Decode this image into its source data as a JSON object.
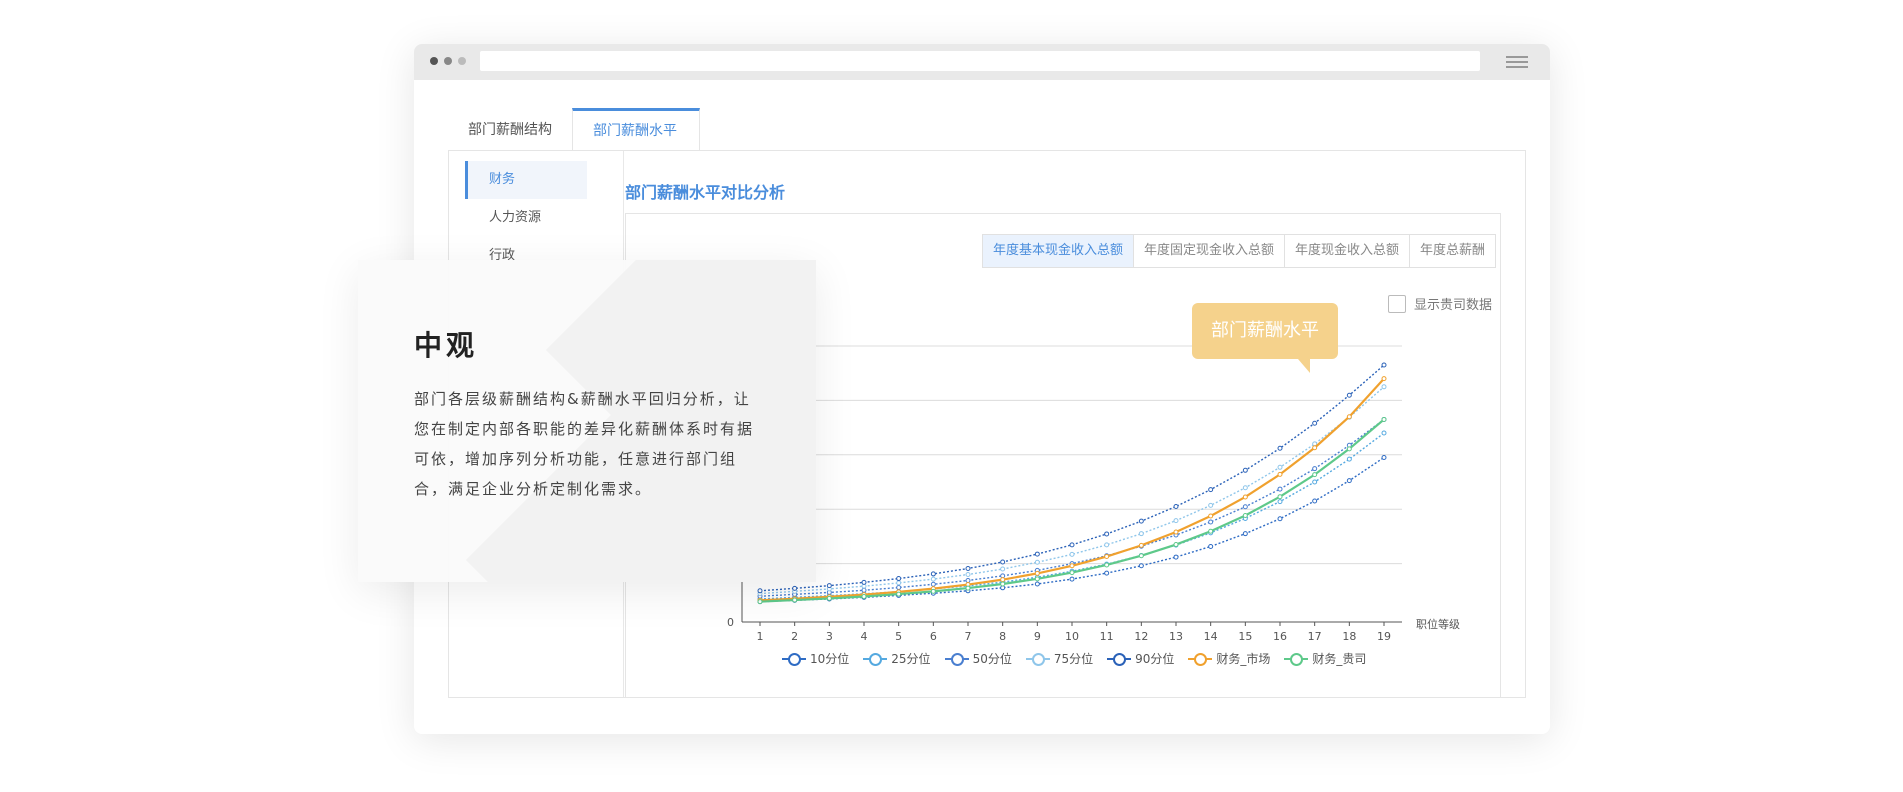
{
  "tabs": [
    {
      "label": "部门薪酬结构",
      "active": false
    },
    {
      "label": "部门薪酬水平",
      "active": true
    }
  ],
  "sidebar": {
    "items": [
      {
        "label": "财务",
        "active": true
      },
      {
        "label": "人力资源",
        "active": false
      },
      {
        "label": "行政",
        "active": false
      }
    ]
  },
  "main": {
    "title": "部门薪酬水平对比分析",
    "segments": [
      {
        "label": "年度基本现金收入总额",
        "active": true
      },
      {
        "label": "年度固定现金收入总额",
        "active": false
      },
      {
        "label": "年度现金收入总额",
        "active": false
      },
      {
        "label": "年度总薪酬",
        "active": false
      }
    ],
    "checkbox_label": "显示贵司数据",
    "checkbox_checked": false
  },
  "tooltip": {
    "text": "部门薪酬水平"
  },
  "card": {
    "title": "中观",
    "text": "部门各层级薪酬结构&薪酬水平回归分析，让您在制定内部各职能的差异化薪酬体系时有据可依，增加序列分析功能，任意进行部门组合，满足企业分析定制化需求。"
  },
  "chart_data": {
    "type": "line",
    "x": [
      1,
      2,
      3,
      4,
      5,
      6,
      7,
      8,
      9,
      10,
      11,
      12,
      13,
      14,
      15,
      16,
      17,
      18,
      19
    ],
    "xlabel": "职位等级",
    "ylabel": "",
    "y_tick_visible": "0",
    "ylim": [
      0,
      100
    ],
    "grid": true,
    "legend_position": "bottom",
    "series": [
      {
        "name": "10分位",
        "color": "#2f6cc4",
        "values": [
          6,
          6.5,
          7,
          7.6,
          8.3,
          9.1,
          10,
          11.1,
          12.5,
          14.3,
          16.5,
          19.2,
          22.4,
          26.3,
          31.0,
          36.5,
          43.0,
          50.5,
          59
        ]
      },
      {
        "name": "25分位",
        "color": "#55a9e0",
        "values": [
          7,
          7.6,
          8.2,
          8.9,
          9.7,
          10.7,
          11.8,
          13.2,
          15.0,
          17.2,
          19.8,
          23.0,
          26.8,
          31.3,
          36.6,
          42.8,
          50.0,
          58.4,
          68
        ]
      },
      {
        "name": "50分位",
        "color": "#4a7fd0",
        "values": [
          8,
          8.7,
          9.4,
          10.2,
          11.2,
          12.4,
          13.8,
          15.5,
          17.5,
          20.0,
          22.9,
          26.4,
          30.5,
          35.3,
          40.9,
          47.4,
          54.9,
          63.5,
          73
        ]
      },
      {
        "name": "75分位",
        "color": "#8fc6ea",
        "values": [
          9,
          9.8,
          10.7,
          11.7,
          12.9,
          14.3,
          16.0,
          18.0,
          20.5,
          23.4,
          26.9,
          31.0,
          35.8,
          41.4,
          47.9,
          55.4,
          64.0,
          73.8,
          85
        ]
      },
      {
        "name": "90分位",
        "color": "#2b62b8",
        "values": [
          10,
          10.9,
          11.9,
          13.1,
          14.5,
          16.2,
          18.2,
          20.6,
          23.5,
          26.9,
          30.9,
          35.6,
          41.0,
          47.2,
          54.3,
          62.4,
          71.6,
          81.9,
          93
        ]
      },
      {
        "name": "财务_市场",
        "color": "#f0a12e",
        "values": [
          6.5,
          7.1,
          7.8,
          8.6,
          9.6,
          10.8,
          12.3,
          14.1,
          16.4,
          19.2,
          22.6,
          26.7,
          31.6,
          37.5,
          44.5,
          52.8,
          62.6,
          74.0,
          88
        ]
      },
      {
        "name": "财务_贵司",
        "color": "#5ec98a",
        "values": [
          6,
          6.6,
          7.2,
          7.9,
          8.8,
          9.8,
          11.0,
          12.5,
          14.4,
          16.7,
          19.5,
          22.9,
          27.0,
          31.9,
          37.7,
          44.6,
          52.7,
          62.2,
          73
        ]
      }
    ]
  }
}
